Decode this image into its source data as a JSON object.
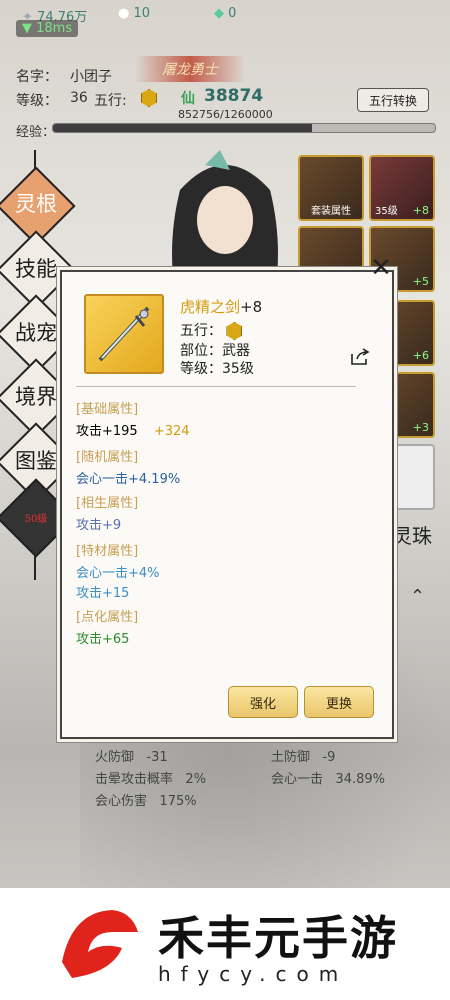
{
  "topbar": {
    "gold": "74.76万",
    "pearl": "10",
    "jade": "0",
    "ping": "18ms"
  },
  "profile": {
    "name_label": "名字：",
    "name": "小团子",
    "title": "屠龙勇士",
    "level_label": "等级：",
    "level": "36",
    "wuxing_label": "五行:",
    "xian_glyph": "仙",
    "power": "38874",
    "exp_text": "852756/1260000",
    "exp_label": "经验：",
    "exp_fraction": 0.677,
    "wuxing_button": "五行转换"
  },
  "sidebar": [
    {
      "label": "灵根"
    },
    {
      "label": "技能"
    },
    {
      "label": "战宠"
    },
    {
      "label": "境界"
    },
    {
      "label": "图鉴"
    }
  ],
  "sidebar_badge": "50级",
  "slots": [
    {
      "label": "套装属性"
    },
    {
      "label": "35级",
      "plus": "+8"
    },
    {
      "plus": "+5"
    },
    {
      "plus": "+6"
    },
    {
      "plus": "+3"
    }
  ],
  "lingzhu": "灵珠",
  "popup": {
    "item_name": "虎精之剑",
    "item_plus": "+8",
    "wuxing_label": "五行：",
    "slot_label": "部位：武器",
    "level_label": "等级：35级",
    "sections": [
      {
        "header": "[基础属性]",
        "rows": [
          {
            "text": "攻击+195",
            "extra": "+324",
            "color": "#222"
          }
        ]
      },
      {
        "header": "[随机属性]",
        "rows": [
          {
            "text": "会心一击+4.19%",
            "color": "#2b5fa0"
          }
        ]
      },
      {
        "header": "[相生属性]",
        "rows": [
          {
            "text": "攻击+9",
            "color": "#5a6fb0"
          }
        ]
      },
      {
        "header": "[特材属性]",
        "rows": [
          {
            "text": "会心一击+4%",
            "color": "#3a8fc4"
          },
          {
            "text": "攻击+15",
            "color": "#3a8fc4"
          }
        ]
      },
      {
        "header": "[点化属性]",
        "rows": [
          {
            "text": "攻击+65",
            "color": "#2e8a2e"
          }
        ]
      }
    ],
    "strengthen_button": "强化",
    "replace_button": "更换"
  },
  "under_stats": [
    {
      "left_label": "火防御",
      "left_value": "-31",
      "right_label": "土防御",
      "right_value": "-9"
    },
    {
      "left_label": "击晕攻击概率",
      "left_value": "2%",
      "right_label": "会心一击",
      "right_value": "34.89%"
    },
    {
      "left_label": "会心伤害",
      "left_value": "175%"
    }
  ],
  "watermark": {
    "text": "禾丰元手游",
    "domain": "hfycy.com"
  },
  "colors": {
    "accent_gold": "#d49a10",
    "frame_gold": "#c48b1f",
    "ping_green": "#7fe08a"
  }
}
